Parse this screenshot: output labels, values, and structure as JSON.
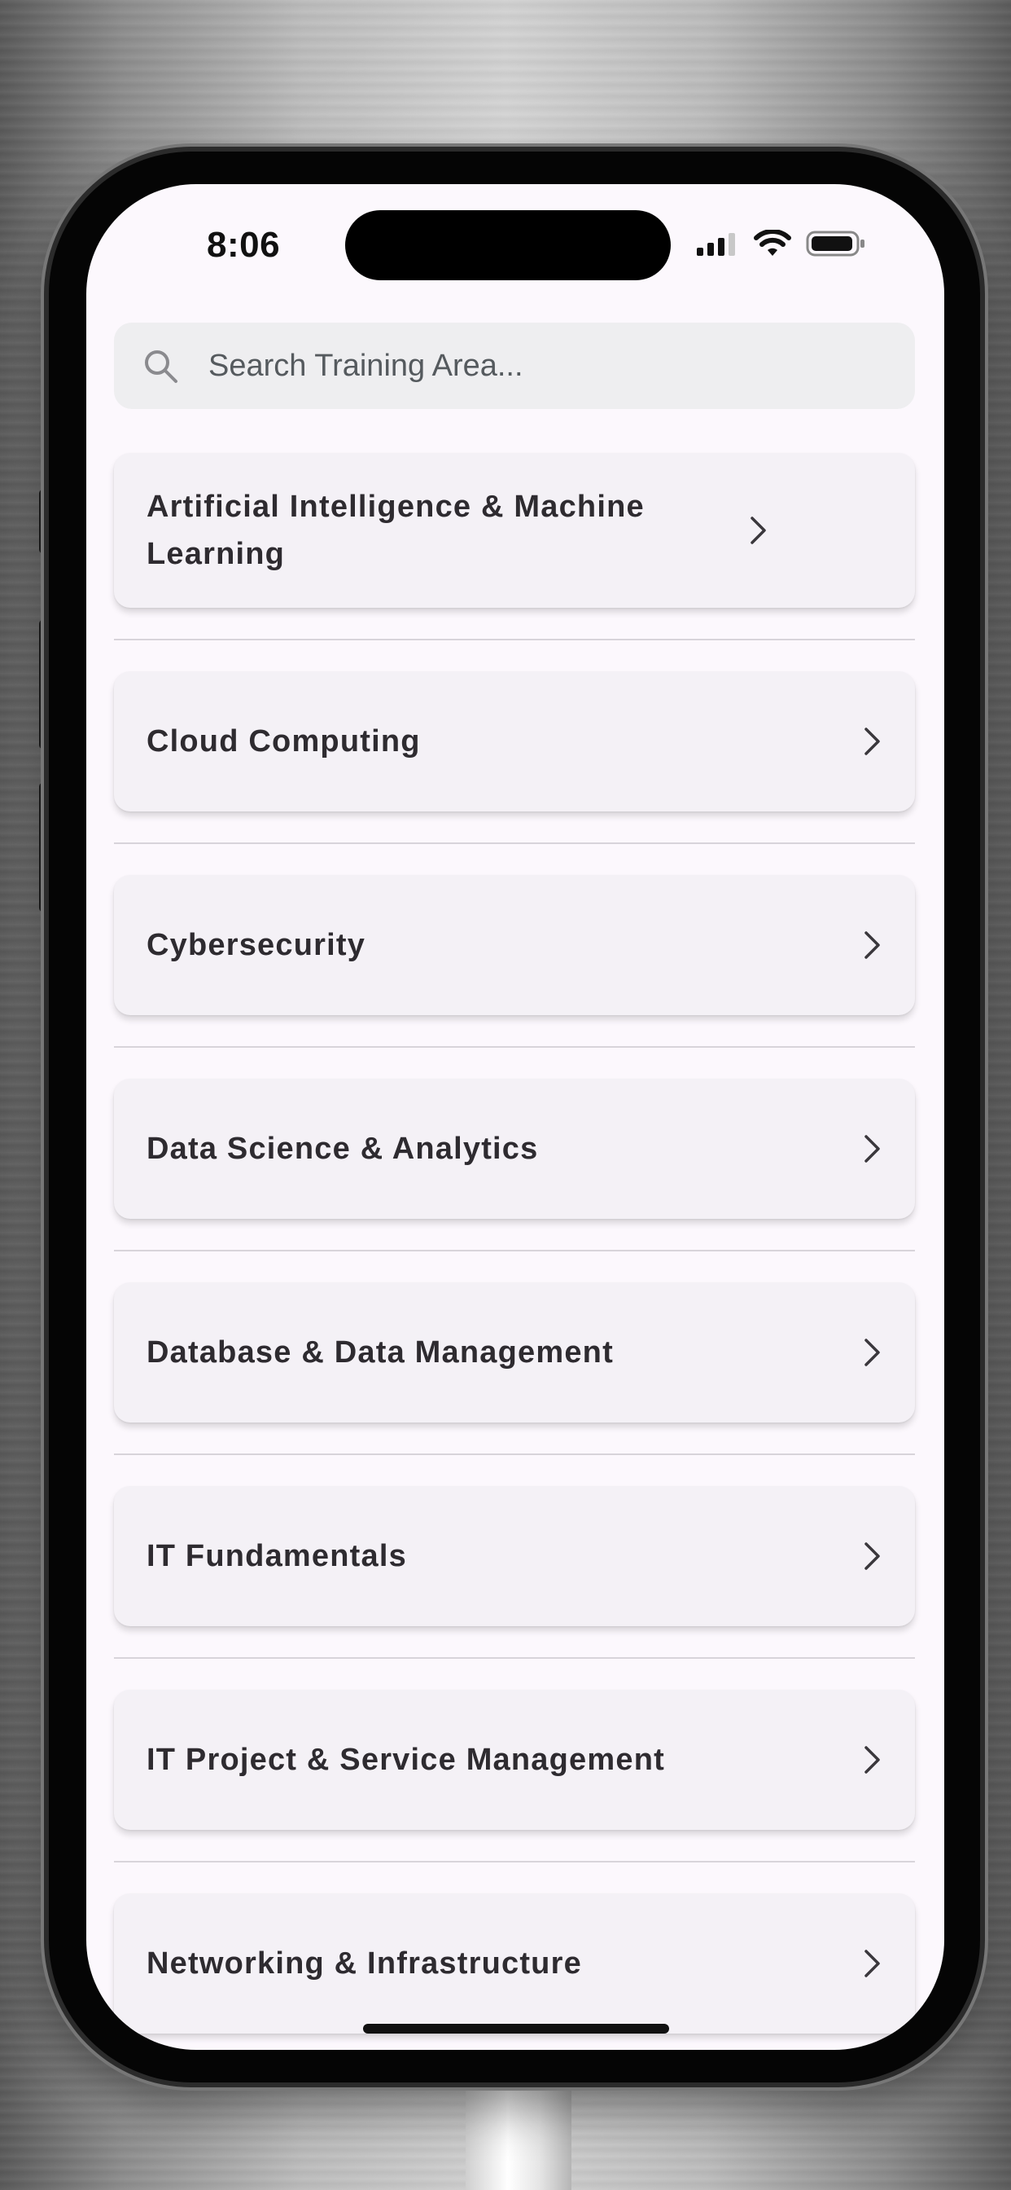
{
  "status_bar": {
    "time": "8:06",
    "icons": [
      "cellular-signal-icon",
      "wifi-icon",
      "battery-icon"
    ]
  },
  "search": {
    "placeholder": "Search Training Area...",
    "value": "",
    "icon": "search-icon"
  },
  "training_areas": [
    {
      "label": "Artificial Intelligence & Machine Learning"
    },
    {
      "label": "Cloud Computing"
    },
    {
      "label": "Cybersecurity"
    },
    {
      "label": "Data Science & Analytics"
    },
    {
      "label": "Database & Data Management"
    },
    {
      "label": "IT Fundamentals"
    },
    {
      "label": "IT Project & Service Management"
    },
    {
      "label": "Networking & Infrastructure"
    }
  ],
  "colors": {
    "screen_background": "#fcf8fd",
    "card_background": "#f4f1f6",
    "search_background": "#eeeef0",
    "text_primary": "#2e2b30"
  }
}
